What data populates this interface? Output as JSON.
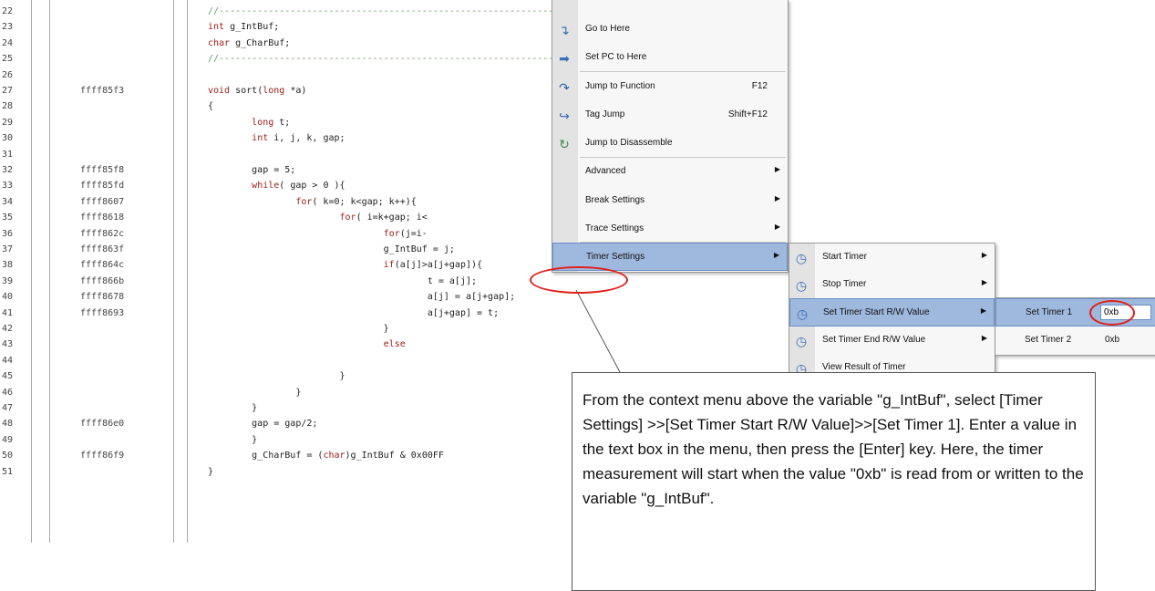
{
  "editor": {
    "lines": [
      {
        "ln": "22",
        "addr": "",
        "code": "//----------------------------------------------------------------------------------------------"
      },
      {
        "ln": "23",
        "addr": "",
        "code": "int g_IntBuf;"
      },
      {
        "ln": "24",
        "addr": "",
        "code": "char g_CharBuf;"
      },
      {
        "ln": "25",
        "addr": "",
        "code": "//----------------------------------------------------------------------------------------------"
      },
      {
        "ln": "26",
        "addr": "",
        "code": ""
      },
      {
        "ln": "27",
        "addr": "ffff85f3",
        "code": "void sort(long *a)"
      },
      {
        "ln": "28",
        "addr": "",
        "code": "{"
      },
      {
        "ln": "29",
        "addr": "",
        "code": "        long t;"
      },
      {
        "ln": "30",
        "addr": "",
        "code": "        int i, j, k, gap;"
      },
      {
        "ln": "31",
        "addr": "",
        "code": ""
      },
      {
        "ln": "32",
        "addr": "ffff85f8",
        "code": "        gap = 5;"
      },
      {
        "ln": "33",
        "addr": "ffff85fd",
        "code": "        while( gap > 0 ){"
      },
      {
        "ln": "34",
        "addr": "ffff8607",
        "code": "                for( k=0; k<gap; k++){"
      },
      {
        "ln": "35",
        "addr": "ffff8618",
        "code": "                        for( i=k+gap; i<"
      },
      {
        "ln": "36",
        "addr": "ffff862c",
        "code": "                                for(j=i-"
      },
      {
        "ln": "37",
        "addr": "ffff863f",
        "code": "                                g_IntBuf = j;"
      },
      {
        "ln": "38",
        "addr": "ffff864c",
        "code": "                                if(a[j]>a[j+gap]){"
      },
      {
        "ln": "39",
        "addr": "ffff866b",
        "code": "                                        t = a[j];"
      },
      {
        "ln": "40",
        "addr": "ffff8678",
        "code": "                                        a[j] = a[j+gap];"
      },
      {
        "ln": "41",
        "addr": "ffff8693",
        "code": "                                        a[j+gap] = t;"
      },
      {
        "ln": "42",
        "addr": "",
        "code": "                                }"
      },
      {
        "ln": "43",
        "addr": "",
        "code": "                                else"
      },
      {
        "ln": "44",
        "addr": "",
        "code": ""
      },
      {
        "ln": "45",
        "addr": "",
        "code": "                        }"
      },
      {
        "ln": "46",
        "addr": "",
        "code": "                }"
      },
      {
        "ln": "47",
        "addr": "",
        "code": "        }"
      },
      {
        "ln": "48",
        "addr": "ffff86e0",
        "code": "        gap = gap/2;"
      },
      {
        "ln": "49",
        "addr": "",
        "code": "        }"
      },
      {
        "ln": "50",
        "addr": "ffff86f9",
        "code": "        g_CharBuf = (char)g_IntBuf & 0x00FF"
      },
      {
        "ln": "51",
        "addr": "",
        "code": "}"
      }
    ]
  },
  "context_menu": {
    "items": [
      {
        "label": "Go to Here",
        "shortcut": "",
        "submenu": false,
        "icon": "go-to-here-icon"
      },
      {
        "label": "Set PC to Here",
        "shortcut": "",
        "submenu": false,
        "icon": "set-pc-icon"
      },
      {
        "label": "Jump to Function",
        "shortcut": "F12",
        "submenu": false,
        "icon": "jump-to-function-icon"
      },
      {
        "label": "Tag Jump",
        "shortcut": "Shift+F12",
        "submenu": false,
        "icon": "tag-jump-icon"
      },
      {
        "label": "Jump to Disassemble",
        "shortcut": "",
        "submenu": false,
        "icon": "jump-to-disassemble-icon"
      },
      {
        "label": "Advanced",
        "shortcut": "",
        "submenu": true,
        "icon": ""
      },
      {
        "label": "Break Settings",
        "shortcut": "",
        "submenu": true,
        "icon": ""
      },
      {
        "label": "Trace Settings",
        "shortcut": "",
        "submenu": true,
        "icon": ""
      },
      {
        "label": "Timer Settings",
        "shortcut": "",
        "submenu": true,
        "icon": ""
      }
    ]
  },
  "timer_menu": {
    "items": [
      {
        "label": "Start Timer",
        "submenu": true,
        "icon": "start-timer-icon"
      },
      {
        "label": "Stop Timer",
        "submenu": true,
        "icon": "stop-timer-icon"
      },
      {
        "label": "Set Timer Start R/W Value",
        "submenu": true,
        "icon": "set-timer-start-icon"
      },
      {
        "label": "Set Timer End R/W Value",
        "submenu": true,
        "icon": "set-timer-end-icon"
      },
      {
        "label": "View Result of Timer",
        "submenu": false,
        "icon": "view-result-icon"
      }
    ]
  },
  "set_timer_menu": {
    "items": [
      {
        "label": "Set Timer 1",
        "value": "0xb"
      },
      {
        "label": "Set Timer 2",
        "value": "0xb"
      }
    ]
  },
  "callout": {
    "text": "From the context menu above the variable \"g_IntBuf\", select [Timer Settings] >>[Set Timer Start R/W Value]>>[Set Timer 1]. Enter a value in the text box in the menu, then press the [Enter] key. Here, the timer measurement will start when the value \"0xb\" is read from or written to the variable \"g_IntBuf\"."
  },
  "colors": {
    "highlight": "#9fb8de",
    "annotation_circle": "#e0201a",
    "keyword": "#a0201a",
    "comment": "#6a9a6a"
  }
}
